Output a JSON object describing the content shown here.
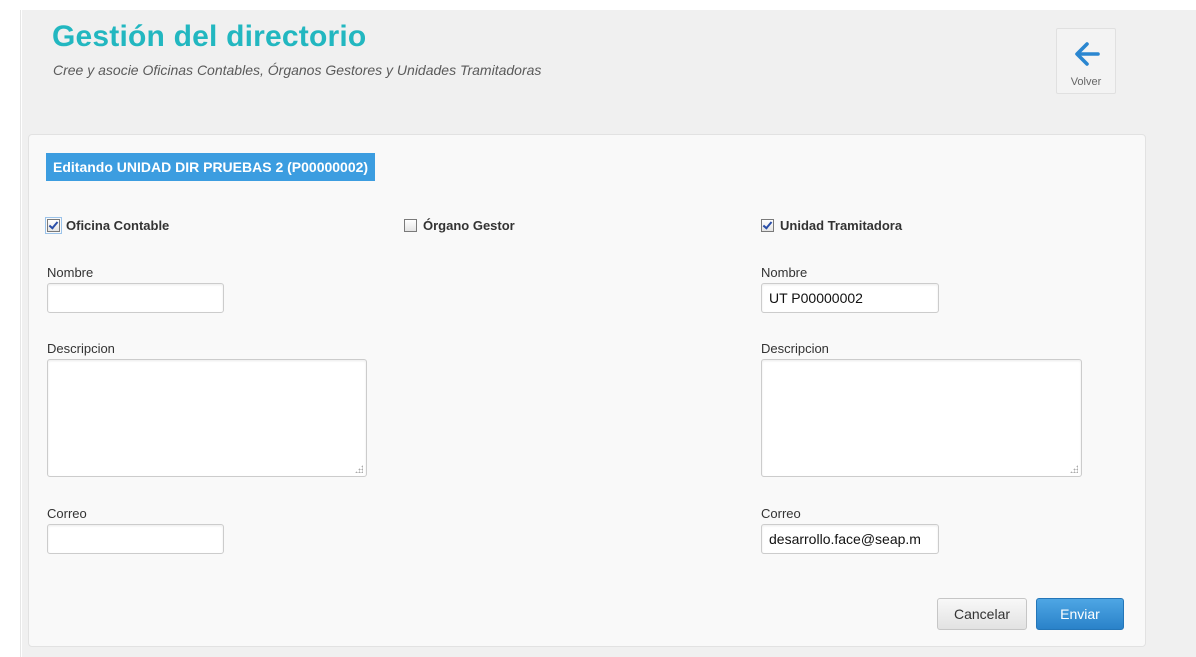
{
  "header": {
    "title": "Gestión del directorio",
    "subtitle": "Cree y asocie Oficinas Contables, Órganos Gestores y Unidades Tramitadoras",
    "back_label": "Volver",
    "back_icon": "arrow-left-icon"
  },
  "form": {
    "badge": "Editando UNIDAD DIR PRUEBAS 2 (P00000002)",
    "colors": {
      "title": "#22b7c0",
      "badge_bg": "#3c9de0",
      "primary_button": "#2a82c9"
    },
    "sections": [
      {
        "checkbox_label": "Oficina Contable",
        "checked": true,
        "nombre_label": "Nombre",
        "nombre_value": "",
        "descripcion_label": "Descripcion",
        "correo_label": "Correo",
        "correo_value": ""
      },
      {
        "checkbox_label": "Órgano Gestor",
        "checked": false
      },
      {
        "checkbox_label": "Unidad Tramitadora",
        "checked": true,
        "nombre_label": "Nombre",
        "nombre_value": "UT P00000002",
        "descripcion_label": "Descripcion",
        "correo_label": "Correo",
        "correo_value": "desarrollo.face@seap.m"
      }
    ],
    "cancel_label": "Cancelar",
    "submit_label": "Enviar"
  }
}
